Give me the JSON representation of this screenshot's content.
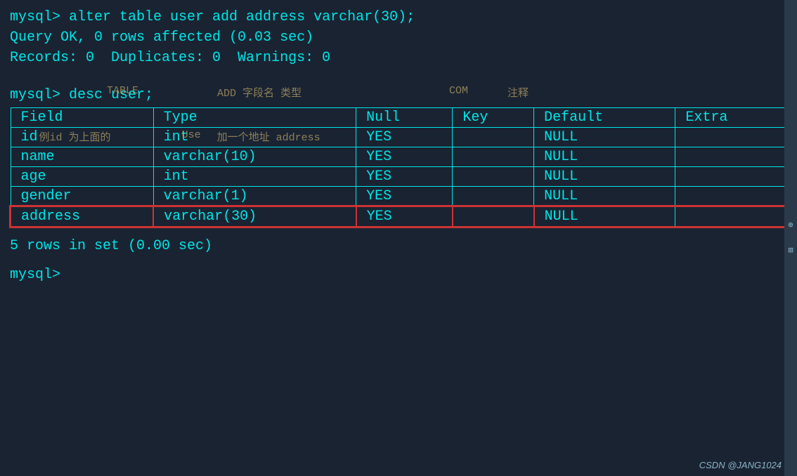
{
  "terminal": {
    "lines": [
      "mysql> alter table user add address varchar(30);",
      "Query OK, 0 rows affected (0.03 sec)",
      "Records: 0  Duplicates: 0  Warnings: 0"
    ],
    "spacer": "",
    "desc_cmd": "mysql> desc user;",
    "table": {
      "headers": [
        "Field",
        "Type",
        "Null",
        "Key",
        "Default",
        "Extra"
      ],
      "rows": [
        {
          "field": "id",
          "type": "int",
          "null": "YES",
          "key": "",
          "default": "NULL",
          "extra": "",
          "highlighted": false
        },
        {
          "field": "name",
          "type": "varchar(10)",
          "null": "YES",
          "key": "",
          "default": "NULL",
          "extra": "",
          "highlighted": false
        },
        {
          "field": "age",
          "type": "int",
          "null": "YES",
          "key": "",
          "default": "NULL",
          "extra": "",
          "highlighted": false
        },
        {
          "field": "gender",
          "type": "varchar(1)",
          "null": "YES",
          "key": "",
          "default": "NULL",
          "extra": "",
          "highlighted": false
        },
        {
          "field": "address",
          "type": "varchar(30)",
          "null": "YES",
          "key": "",
          "default": "NULL",
          "extra": "",
          "highlighted": true
        }
      ]
    },
    "footer": "5 rows in set (0.00 sec)",
    "final_prompt": "mysql>"
  },
  "overlays": {
    "table_label": "TABLE",
    "add_label": "ADD 字段名 类型",
    "com_label": "COM",
    "annotation_label": "注释",
    "example_label": "例id 为上面的",
    "use_label": "Use",
    "add_field_label": "加一个地址 address"
  },
  "watermark": "CSDN @JANG1024",
  "colors": {
    "bg": "#1a2332",
    "text": "#00e5e5",
    "highlight_border": "#cc3333",
    "overlay": "rgba(180,160,100,0.75)",
    "scrollbar_bg": "#2a3a4a",
    "watermark": "#8ab4c8"
  }
}
